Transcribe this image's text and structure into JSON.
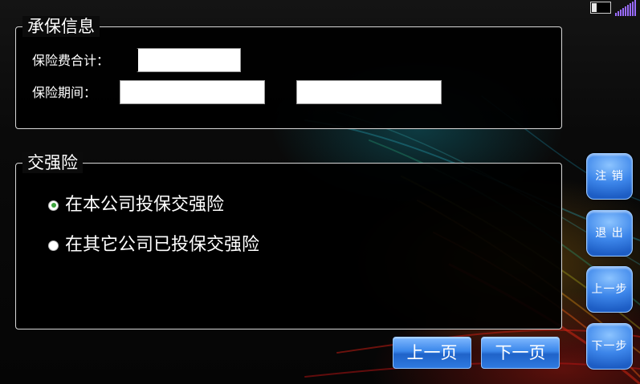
{
  "underwriting": {
    "title": "承保信息",
    "premium_label": "保险费合计：",
    "premium_value": "",
    "period_label": "保险期间：",
    "period_start_value": "",
    "period_end_value": ""
  },
  "compulsory": {
    "title": "交强险",
    "options": [
      {
        "label": "在本公司投保交强险",
        "selected": true
      },
      {
        "label": "在其它公司已投保交强险",
        "selected": false
      }
    ]
  },
  "pager": {
    "prev_label": "上一页",
    "next_label": "下一页"
  },
  "side_buttons": {
    "logout": "注 销",
    "exit": "退 出",
    "prev_step": "上一步",
    "next_step": "下一步"
  },
  "status": {
    "battery_icon": "battery-low-icon",
    "signal_icon": "signal-strength-icon",
    "signal_color": "#9a6cff"
  },
  "colors": {
    "button_blue": "#3a86ea",
    "radio_selected": "#3fa53f"
  }
}
